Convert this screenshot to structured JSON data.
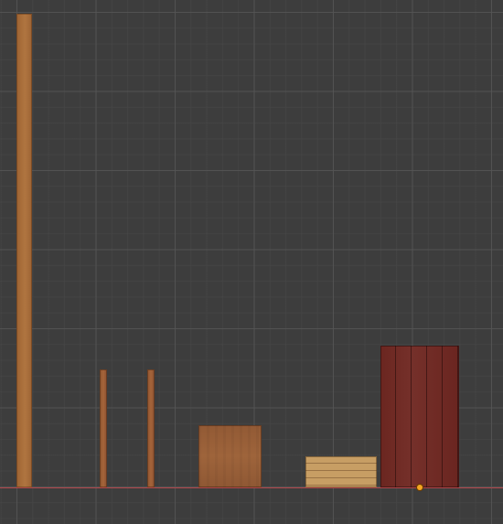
{
  "scene": {
    "objects": [
      {
        "id": "tall-plank",
        "material": "light-wood"
      },
      {
        "id": "post-left",
        "material": "wood"
      },
      {
        "id": "post-right",
        "material": "wood"
      },
      {
        "id": "crate",
        "material": "wood"
      },
      {
        "id": "plank-stack",
        "material": "light-wood"
      },
      {
        "id": "wall-panel",
        "material": "dark-red-wood"
      }
    ]
  },
  "colors": {
    "background": "#3d3d3d",
    "grid": "#555555",
    "x_axis": "#b2474b",
    "origin": "#f5a623"
  }
}
